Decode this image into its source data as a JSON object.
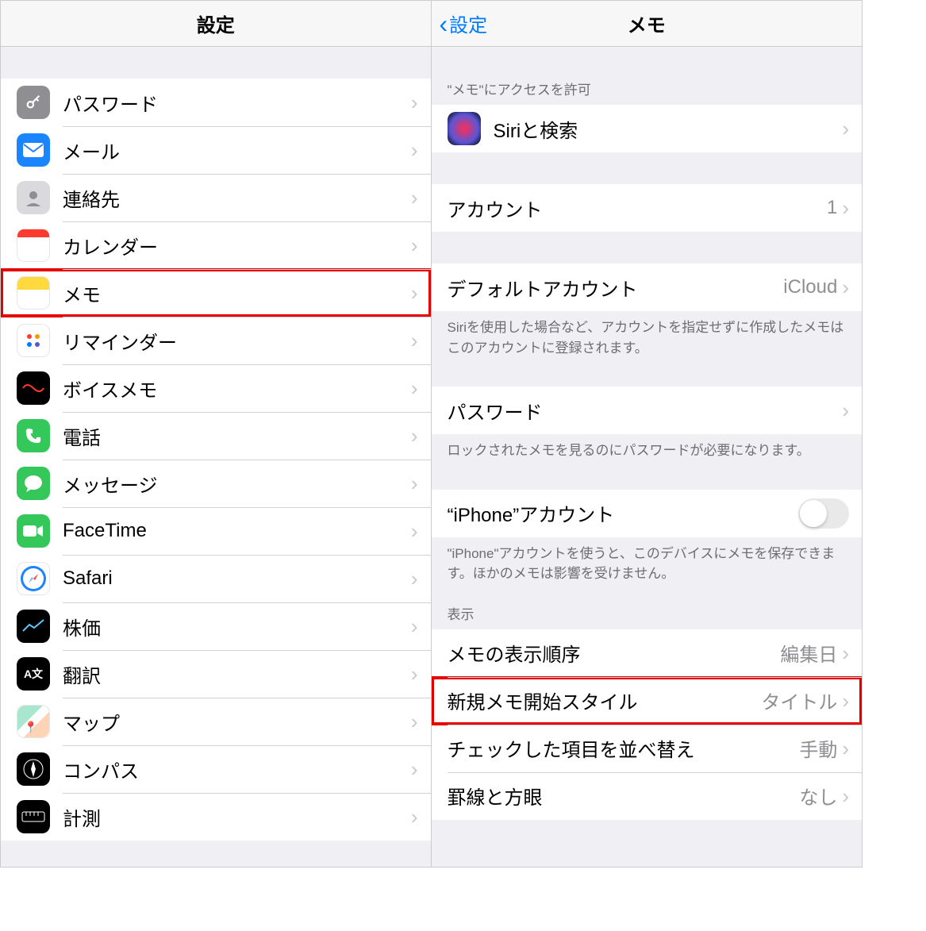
{
  "left": {
    "title": "設定",
    "items": [
      {
        "key": "passwords",
        "label": "パスワード"
      },
      {
        "key": "mail",
        "label": "メール"
      },
      {
        "key": "contacts",
        "label": "連絡先"
      },
      {
        "key": "calendar",
        "label": "カレンダー"
      },
      {
        "key": "notes",
        "label": "メモ",
        "highlight": true
      },
      {
        "key": "reminders",
        "label": "リマインダー"
      },
      {
        "key": "voicememo",
        "label": "ボイスメモ"
      },
      {
        "key": "phone",
        "label": "電話"
      },
      {
        "key": "messages",
        "label": "メッセージ"
      },
      {
        "key": "facetime",
        "label": "FaceTime"
      },
      {
        "key": "safari",
        "label": "Safari"
      },
      {
        "key": "stocks",
        "label": "株価"
      },
      {
        "key": "translate",
        "label": "翻訳"
      },
      {
        "key": "maps",
        "label": "マップ"
      },
      {
        "key": "compass",
        "label": "コンパス"
      },
      {
        "key": "measure",
        "label": "計測"
      }
    ]
  },
  "right": {
    "back": "設定",
    "title": "メモ",
    "allow_header": "\"メモ\"にアクセスを許可",
    "siri": "Siriと検索",
    "accounts_label": "アカウント",
    "accounts_value": "1",
    "default_account_label": "デフォルトアカウント",
    "default_account_value": "iCloud",
    "default_account_footer": "Siriを使用した場合など、アカウントを指定せずに作成したメモはこのアカウントに登録されます。",
    "password_label": "パスワード",
    "password_footer": "ロックされたメモを見るのにパスワードが必要になります。",
    "iphone_account_label": "“iPhone”アカウント",
    "iphone_account_footer": "\"iPhone\"アカウントを使うと、このデバイスにメモを保存できます。ほかのメモは影響を受けません。",
    "display_header": "表示",
    "sort_label": "メモの表示順序",
    "sort_value": "編集日",
    "newnote_label": "新規メモ開始スタイル",
    "newnote_value": "タイトル",
    "checked_label": "チェックした項目を並べ替え",
    "checked_value": "手動",
    "lines_label": "罫線と方眼",
    "lines_value": "なし"
  }
}
